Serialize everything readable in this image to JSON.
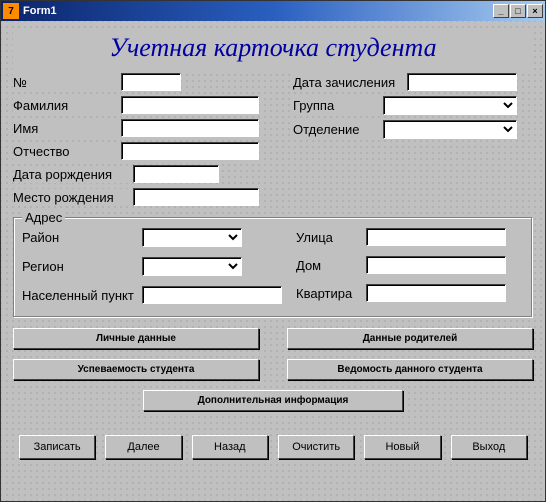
{
  "window": {
    "title": "Form1"
  },
  "heading": "Учетная карточка студента",
  "fields": {
    "num_label": "№",
    "num_value": "",
    "fam_label": "Фамилия",
    "fam_value": "",
    "name_label": "Имя",
    "name_value": "",
    "otch_label": "Отчество",
    "otch_value": "",
    "dob_label": "Дата рорждения",
    "dob_value": "",
    "pob_label": "Место рождения",
    "pob_value": "",
    "enroll_label": "Дата зачисления",
    "enroll_value": "",
    "group_label": "Группа",
    "group_value": "",
    "dept_label": "Отделение",
    "dept_value": ""
  },
  "address": {
    "legend": "Адрес",
    "rayon_label": "Район",
    "rayon_value": "",
    "region_label": "Регион",
    "region_value": "",
    "town_label": "Населенный пункт",
    "town_value": "",
    "street_label": "Улица",
    "street_value": "",
    "house_label": "Дом",
    "house_value": "",
    "flat_label": "Квартира",
    "flat_value": ""
  },
  "buttons": {
    "personal": "Личные данные",
    "parents": "Данные родителей",
    "progress": "Успеваемость студента",
    "record": "Ведомость данного студента",
    "extra": "Дополнительная информация",
    "save": "Записать",
    "next": "Далее",
    "back": "Назад",
    "clear": "Очистить",
    "new": "Новый",
    "exit": "Выход"
  }
}
